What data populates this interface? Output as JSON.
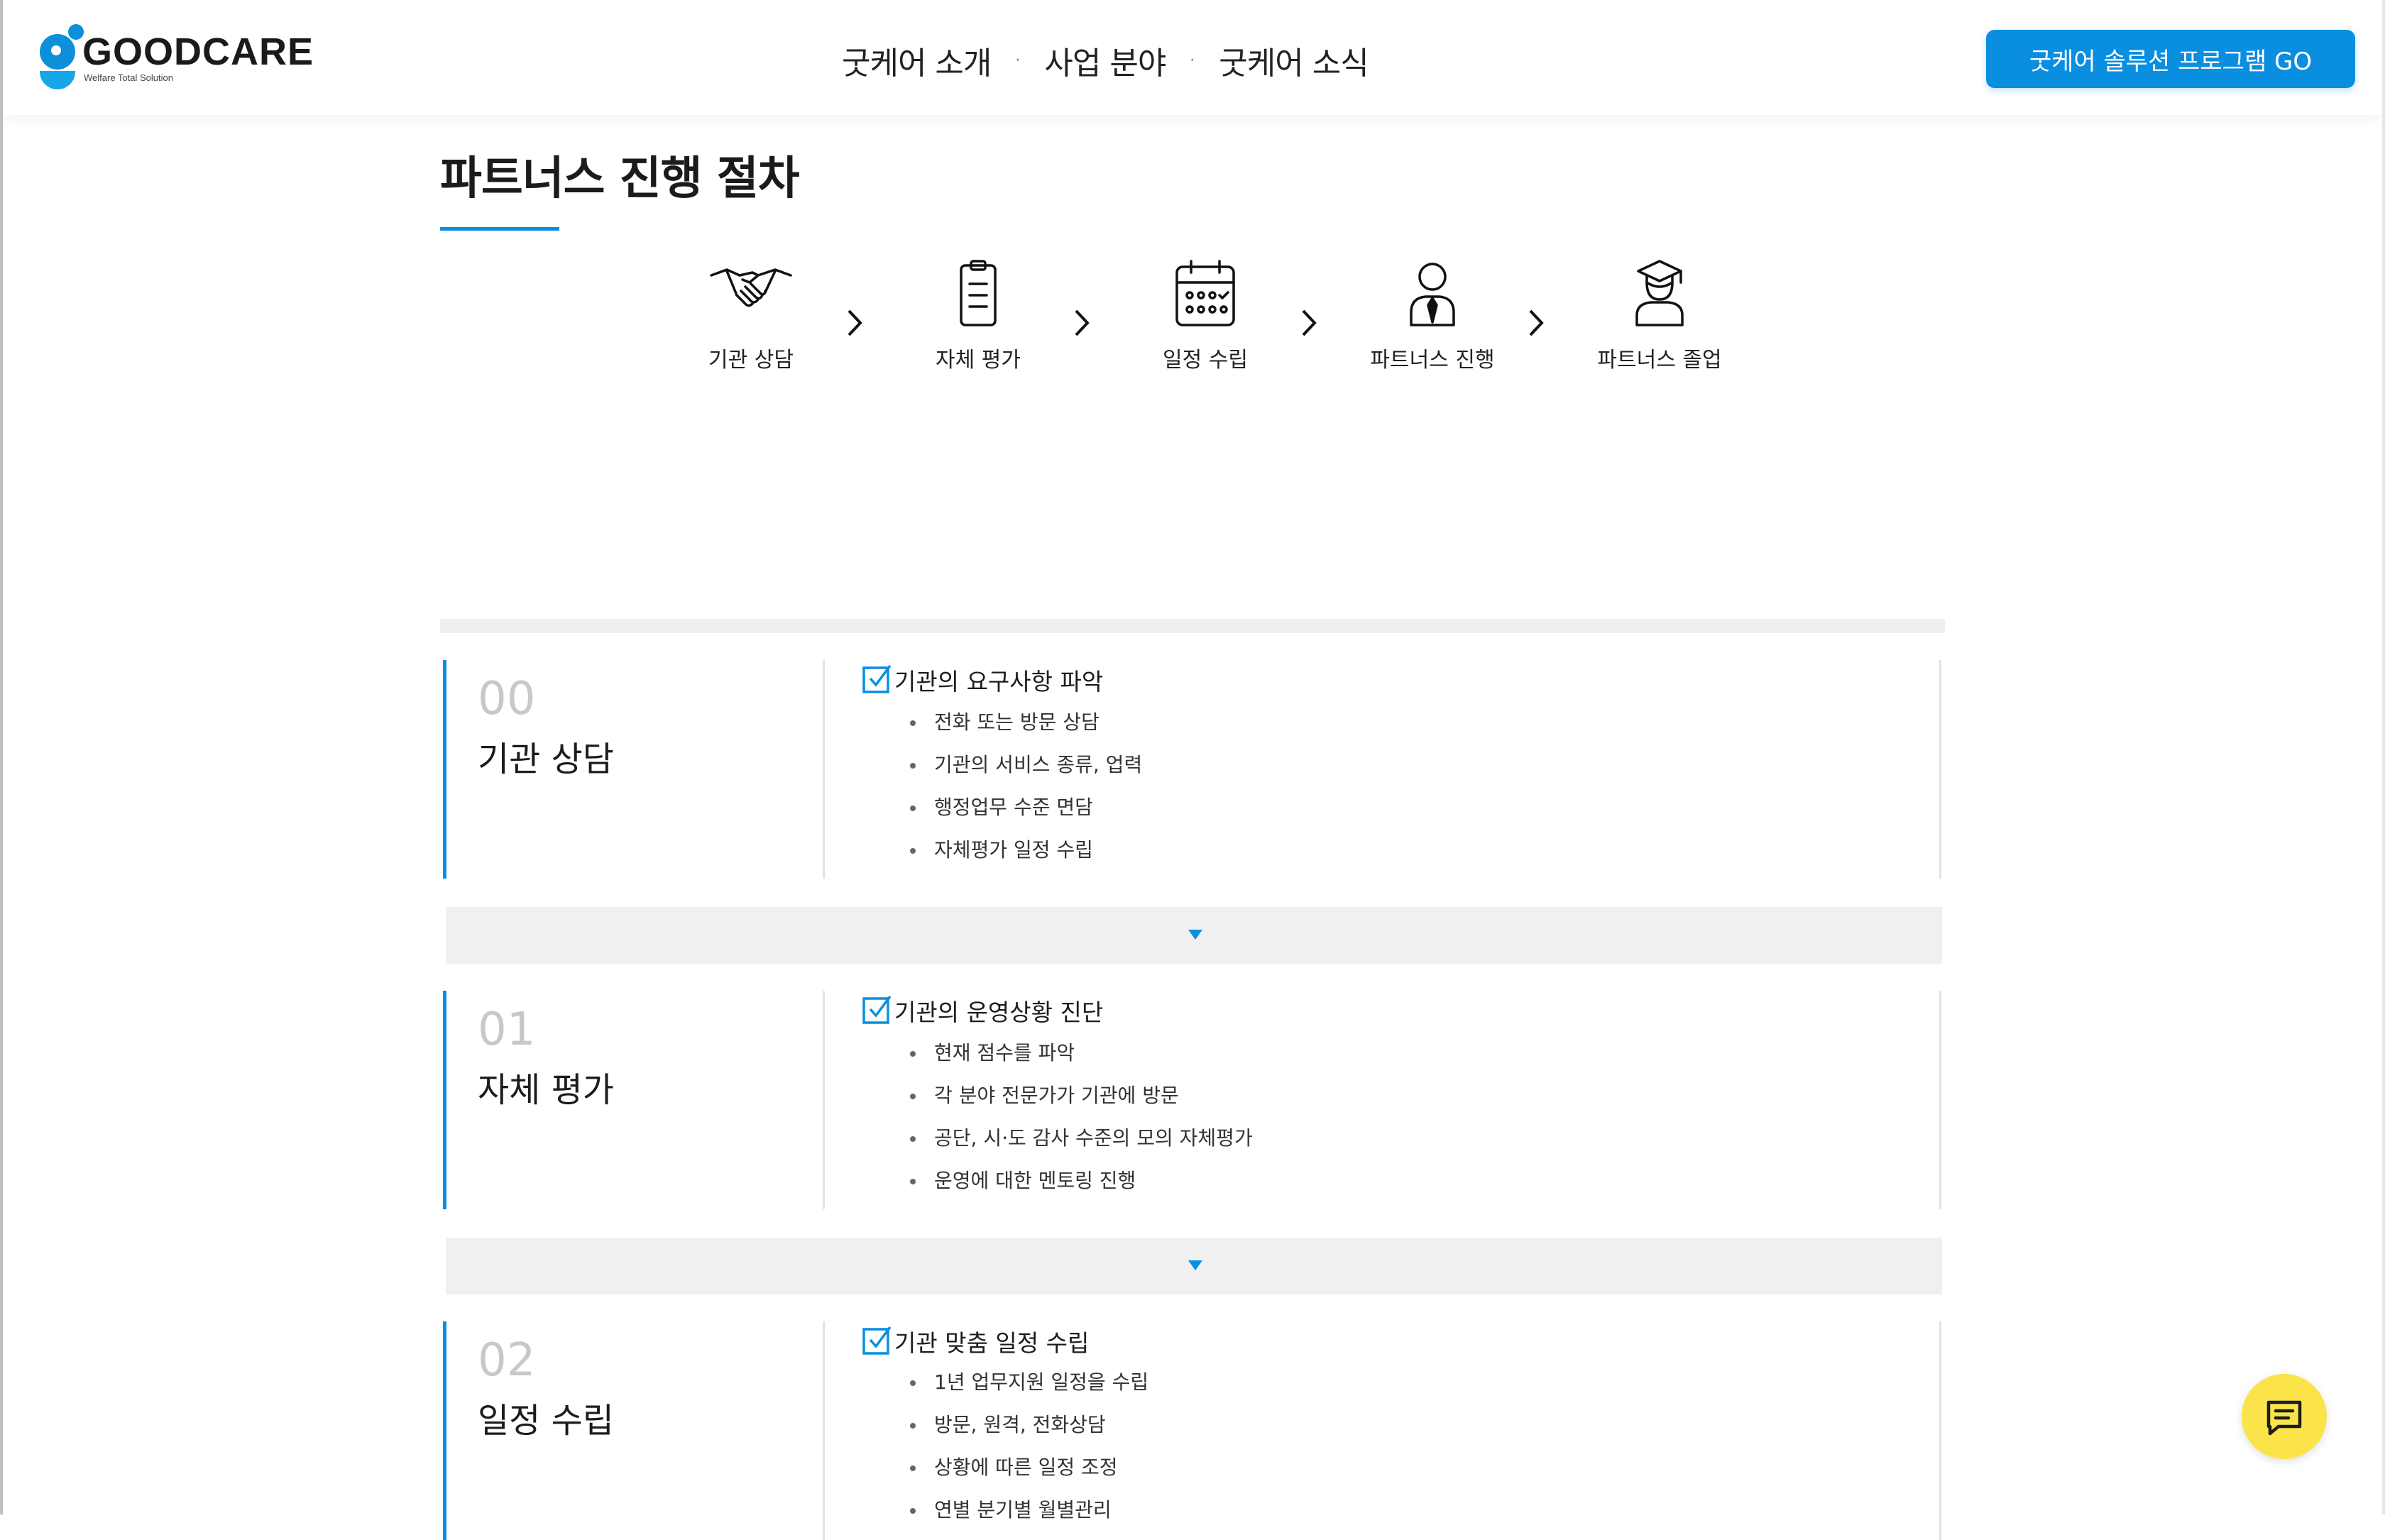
{
  "brand": {
    "name": "GOODCARE",
    "tagline": "Welfare Total Solution",
    "accent": "#0a8ee0"
  },
  "nav": {
    "items": [
      "굿케어 소개",
      "사업 분야",
      "굿케어 소식"
    ],
    "separator": "·"
  },
  "cta": {
    "label": "굿케어 솔루션 프로그램 GO"
  },
  "page": {
    "title": "파트너스 진행 절차"
  },
  "steps": [
    {
      "label": "기관 상담",
      "icon": "handshake-icon"
    },
    {
      "label": "자체 평가",
      "icon": "clipboard-icon"
    },
    {
      "label": "일정 수립",
      "icon": "calendar-icon"
    },
    {
      "label": "파트너스 진행",
      "icon": "person-tie-icon"
    },
    {
      "label": "파트너스 졸업",
      "icon": "graduate-icon"
    }
  ],
  "cards": [
    {
      "num": "00",
      "name": "기관 상담",
      "heading": "기관의 요구사항 파악",
      "items": [
        "전화 또는 방문 상담",
        "기관의 서비스 종류, 업력",
        "행정업무 수준 면담",
        "자체평가 일정 수립"
      ]
    },
    {
      "num": "01",
      "name": "자체 평가",
      "heading": "기관의 운영상황 진단",
      "items": [
        "현재 점수를 파악",
        "각 분야 전문가가 기관에 방문",
        "공단, 시·도 감사 수준의 모의 자체평가",
        "운영에 대한 멘토링 진행"
      ]
    },
    {
      "num": "02",
      "name": "일정 수립",
      "heading": "기관 맞춤 일정 수립",
      "items": [
        "1년 업무지원 일정을 수립",
        "방문, 원격, 전화상담",
        "상황에 따른 일정 조정",
        "연별 분기별 월별관리"
      ]
    }
  ],
  "chat": {
    "icon": "chat-icon",
    "color": "#fbe34a"
  }
}
